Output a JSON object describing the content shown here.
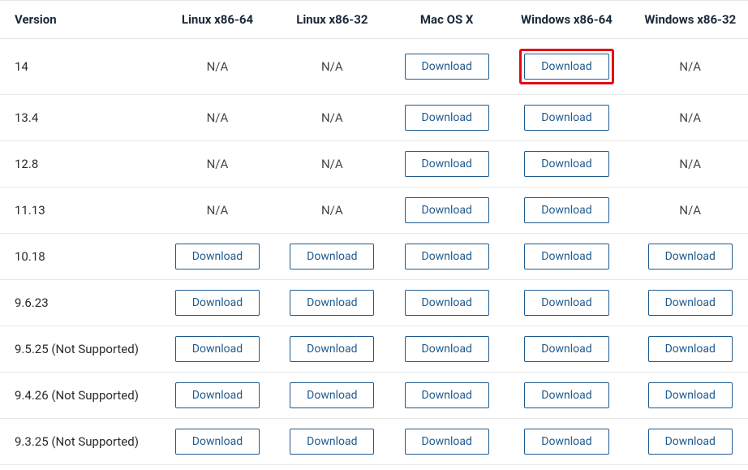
{
  "table": {
    "headers": [
      "Version",
      "Linux x86-64",
      "Linux x86-32",
      "Mac OS X",
      "Windows x86-64",
      "Windows x86-32"
    ],
    "download_label": "Download",
    "na_label": "N/A",
    "rows": [
      {
        "version": "14",
        "cells": [
          "na",
          "na",
          "dl",
          "dl-hl",
          "na"
        ]
      },
      {
        "version": "13.4",
        "cells": [
          "na",
          "na",
          "dl",
          "dl",
          "na"
        ]
      },
      {
        "version": "12.8",
        "cells": [
          "na",
          "na",
          "dl",
          "dl",
          "na"
        ]
      },
      {
        "version": "11.13",
        "cells": [
          "na",
          "na",
          "dl",
          "dl",
          "na"
        ]
      },
      {
        "version": "10.18",
        "cells": [
          "dl",
          "dl",
          "dl",
          "dl",
          "dl"
        ]
      },
      {
        "version": "9.6.23",
        "cells": [
          "dl",
          "dl",
          "dl",
          "dl",
          "dl"
        ]
      },
      {
        "version": "9.5.25 (Not Supported)",
        "cells": [
          "dl",
          "dl",
          "dl",
          "dl",
          "dl"
        ]
      },
      {
        "version": "9.4.26 (Not Supported)",
        "cells": [
          "dl",
          "dl",
          "dl",
          "dl",
          "dl"
        ]
      },
      {
        "version": "9.3.25 (Not Supported)",
        "cells": [
          "dl",
          "dl",
          "dl",
          "dl",
          "dl"
        ]
      }
    ]
  }
}
